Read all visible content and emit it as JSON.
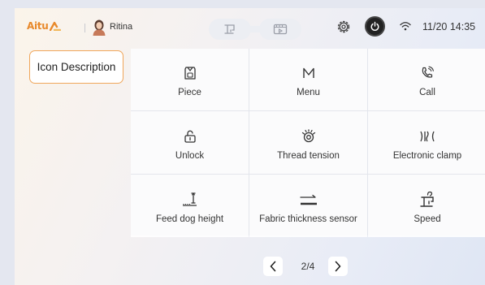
{
  "header": {
    "brand": "Aitu",
    "user_name": "Ritina",
    "time": "11/20 14:35",
    "icons": [
      "machine-mode-icon",
      "film-mode-icon",
      "gear-icon",
      "power-icon",
      "wifi-icon"
    ]
  },
  "sidebar": {
    "active_tab": "Icon Description"
  },
  "icons": [
    {
      "label": "Piece",
      "icon": "piece-icon"
    },
    {
      "label": "Menu",
      "icon": "menu-icon"
    },
    {
      "label": "Call",
      "icon": "call-icon"
    },
    {
      "label": "Unlock",
      "icon": "unlock-icon"
    },
    {
      "label": "Thread tension",
      "icon": "thread-tension-icon"
    },
    {
      "label": "Electronic clamp",
      "icon": "electronic-clamp-icon"
    },
    {
      "label": "Feed dog height",
      "icon": "feed-dog-height-icon"
    },
    {
      "label": "Fabric thickness sensor",
      "icon": "fabric-thickness-icon"
    },
    {
      "label": "Speed",
      "icon": "speed-icon"
    }
  ],
  "pager": {
    "text": "2/4"
  },
  "colors": {
    "accent": "#f0a65a",
    "brand": "#e8892b"
  }
}
